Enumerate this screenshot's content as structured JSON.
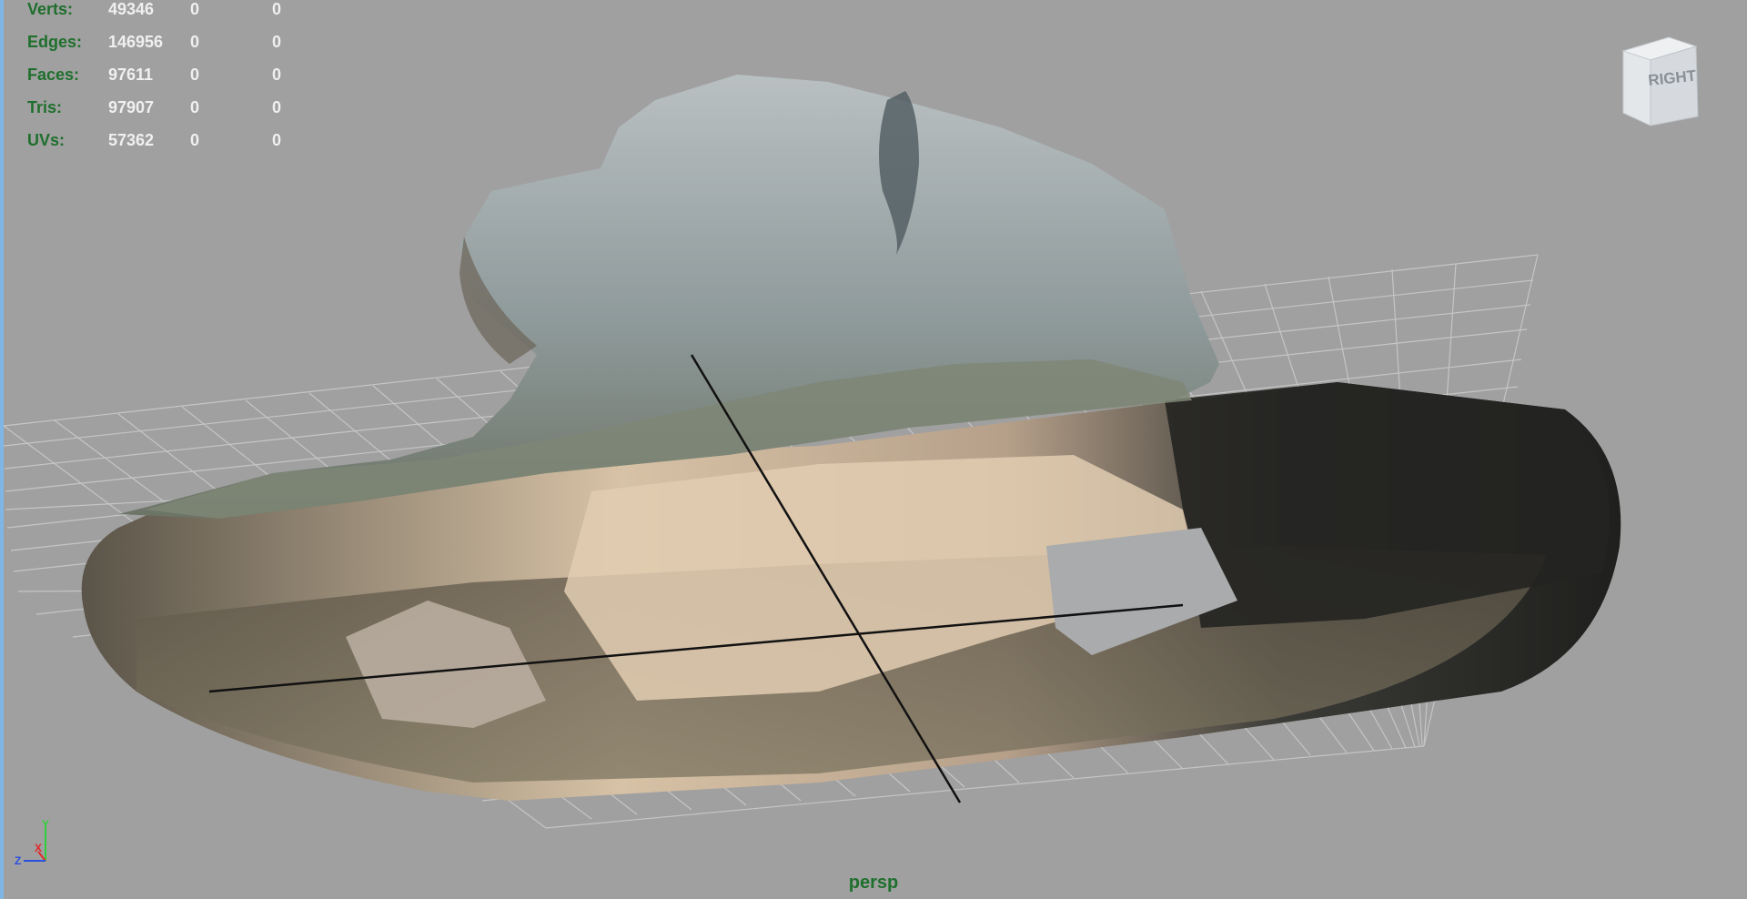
{
  "hud": {
    "rows": [
      {
        "label": "Verts:",
        "v1": "49346",
        "v2": "0",
        "v3": "0"
      },
      {
        "label": "Edges:",
        "v1": "146956",
        "v2": "0",
        "v3": "0"
      },
      {
        "label": "Faces:",
        "v1": "97611",
        "v2": "0",
        "v3": "0"
      },
      {
        "label": "Tris:",
        "v1": "97907",
        "v2": "0",
        "v3": "0"
      },
      {
        "label": "UVs:",
        "v1": "57362",
        "v2": "0",
        "v3": "0"
      }
    ]
  },
  "viewcube": {
    "face_label": "RIGHT"
  },
  "axis": {
    "x": "X",
    "y": "Y",
    "z": "Z"
  },
  "camera": {
    "name": "persp"
  },
  "colors": {
    "background": "#a0a0a0",
    "hud_label": "#1f6f2d",
    "hud_value": "#f0f0f0",
    "grid": "#c8c8c8"
  }
}
